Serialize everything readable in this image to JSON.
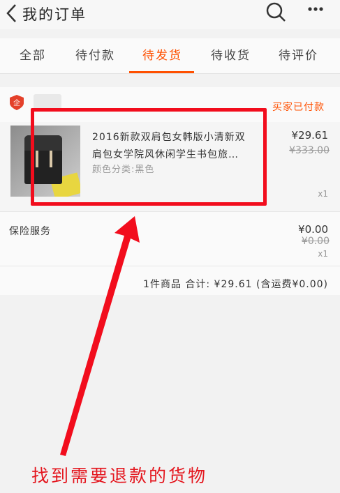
{
  "header": {
    "title": "我的订单",
    "back_icon": "chevron-left-icon",
    "search_icon": "search-icon",
    "more_icon": "more-icon"
  },
  "tabs": [
    {
      "label": "全部"
    },
    {
      "label": "待付款"
    },
    {
      "label": "待发货",
      "active": true
    },
    {
      "label": "待收货"
    },
    {
      "label": "待评价"
    }
  ],
  "order": {
    "status": "买家已付款",
    "product": {
      "title_line1": "2016新款双肩包女韩版小清新双",
      "title_line2": "肩包女学院风休闲学生书包旅…",
      "variant": "颜色分类:黑色",
      "price": "¥29.61",
      "original_price": "¥333.00",
      "quantity": "x1"
    },
    "insurance": {
      "label": "保险服务",
      "price": "¥0.00",
      "original_price": "¥0.00",
      "quantity": "x1"
    },
    "summary": "1件商品  合计: ¥29.61 (含运费¥0.00)"
  },
  "annotation": {
    "text": "找到需要退款的货物",
    "color": "#e4161e"
  },
  "colors": {
    "accent": "#ff5000",
    "annotation_red": "#f20d1d"
  }
}
